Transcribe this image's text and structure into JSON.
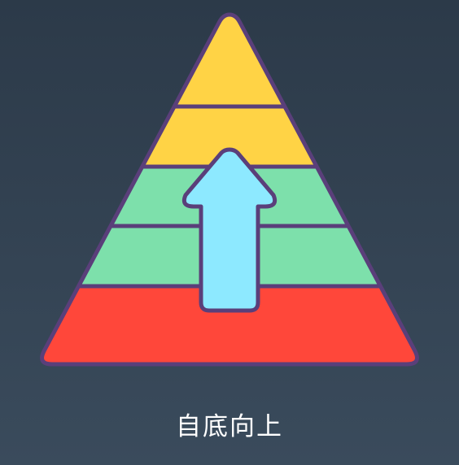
{
  "caption": "自底向上",
  "colors": {
    "background_top": "#2c3a49",
    "background_bottom": "#3a4b5c",
    "outline": "#5a3f7a",
    "tier_top": "#ffd345",
    "tier_middle": "#7de0ab",
    "tier_bottom": "#ff473a",
    "arrow": "#8de9ff"
  },
  "icons": {
    "pyramid": "pyramid-icon",
    "arrow": "arrow-up-icon"
  }
}
